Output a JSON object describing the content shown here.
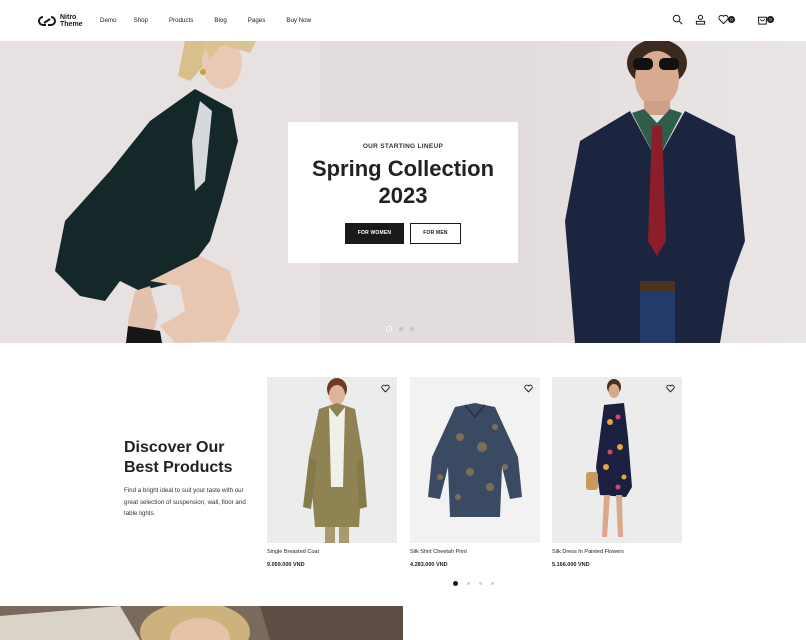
{
  "logo": {
    "line1": "Nitro",
    "line2": "Theme"
  },
  "nav": [
    {
      "label": "Demo"
    },
    {
      "label": "Shop"
    },
    {
      "label": "Products"
    },
    {
      "label": "Blog"
    },
    {
      "label": "Pages"
    },
    {
      "label": "Buy Now"
    }
  ],
  "header_icons": {
    "search": "search-icon",
    "account": "user-icon",
    "wishlist": "heart-icon",
    "wishlist_count": "0",
    "cart": "cart-icon",
    "cart_count": "0"
  },
  "hero": {
    "eyebrow": "OUR STARTING LINEUP",
    "title": "Spring Collection 2023",
    "btn_women": "FOR WOMEN",
    "btn_men": "FOR MEN",
    "slide_index": 1,
    "slide_count": 3
  },
  "promo": {
    "title": "Discover Our Best Products",
    "description": "Find a bright ideal to suit your taste with our great selection of suspension, wall, floor and table lights."
  },
  "products": [
    {
      "name": "Single Breasted Coat",
      "price": "9.059.000 VND"
    },
    {
      "name": "Silk Shirt Cheetah Print",
      "price": "4.283.000 VND"
    },
    {
      "name": "Silk Dress In Painted Flowers",
      "price": "5.166.000 VND"
    }
  ],
  "carousel": {
    "page_index": 1,
    "page_count": 4
  },
  "colors": {
    "accent": "#1a1a1a",
    "hero_bg": "#e3dcdd",
    "product_bg": "#ececec"
  }
}
